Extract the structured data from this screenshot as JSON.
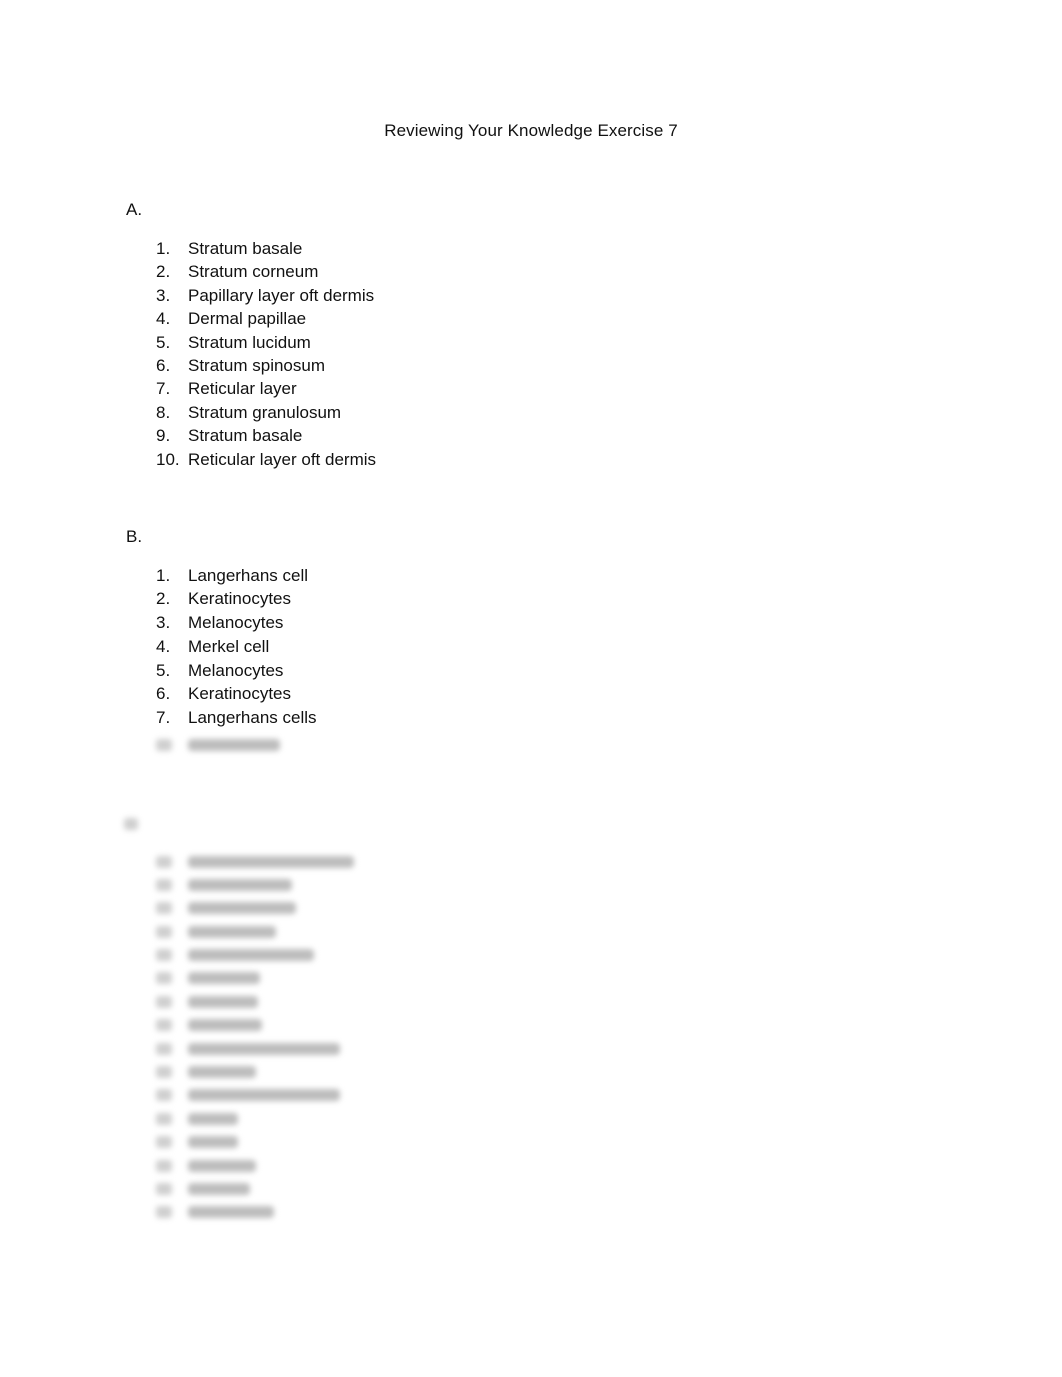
{
  "document": {
    "title": "Reviewing Your Knowledge Exercise 7",
    "sections": [
      {
        "label": "A.",
        "items": [
          {
            "num": "1.",
            "text": "Stratum basale"
          },
          {
            "num": "2.",
            "text": "Stratum corneum"
          },
          {
            "num": "3.",
            "text": "Papillary layer oft dermis"
          },
          {
            "num": "4.",
            "text": "Dermal papillae"
          },
          {
            "num": "5.",
            "text": "Stratum lucidum"
          },
          {
            "num": "6.",
            "text": "Stratum spinosum"
          },
          {
            "num": "7.",
            "text": "Reticular layer"
          },
          {
            "num": "8.",
            "text": "Stratum granulosum"
          },
          {
            "num": "9.",
            "text": "Stratum basale"
          },
          {
            "num": "10.",
            "text": "Reticular layer oft dermis"
          }
        ]
      },
      {
        "label": "B.",
        "items": [
          {
            "num": "1.",
            "text": "Langerhans cell"
          },
          {
            "num": "2.",
            "text": "Keratinocytes"
          },
          {
            "num": "3.",
            "text": "Melanocytes"
          },
          {
            "num": "4.",
            "text": "Merkel cell"
          },
          {
            "num": "5.",
            "text": "Melanocytes"
          },
          {
            "num": "6.",
            "text": "Keratinocytes"
          },
          {
            "num": "7.",
            "text": "Langerhans cells"
          }
        ],
        "blurred_item_count": 1
      },
      {
        "label": "",
        "blurred": true,
        "blurred_item_count": 16
      }
    ]
  }
}
